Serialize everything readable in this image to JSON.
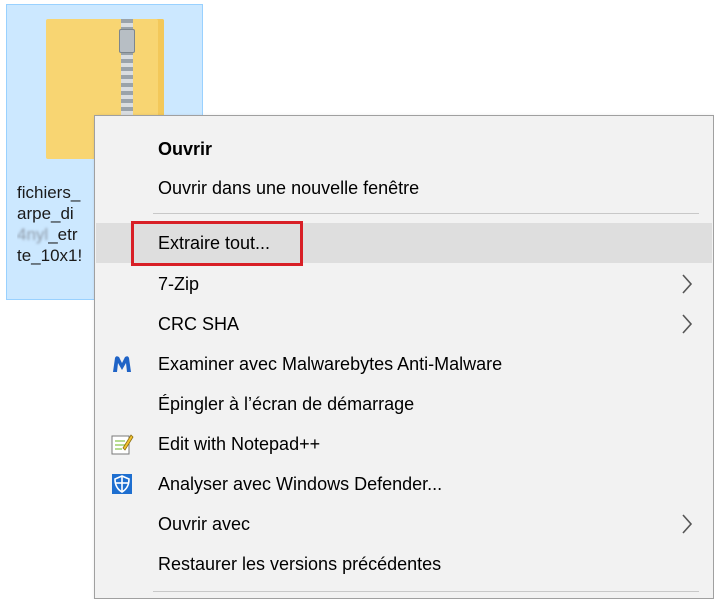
{
  "file": {
    "name_lines": [
      "fichiers_",
      "arpe_di",
      "_etr",
      "te_10x1!"
    ],
    "icon": "zip-folder-icon"
  },
  "context_menu": {
    "items": [
      {
        "label": "Ouvrir",
        "bold": true,
        "icon": null,
        "submenu": false
      },
      {
        "label": "Ouvrir dans une nouvelle fenêtre",
        "bold": false,
        "icon": null,
        "submenu": false
      },
      {
        "label": "Extraire tout...",
        "bold": false,
        "icon": null,
        "submenu": false,
        "hovered": true,
        "highlighted": true
      },
      {
        "label": "7-Zip",
        "bold": false,
        "icon": null,
        "submenu": true
      },
      {
        "label": "CRC SHA",
        "bold": false,
        "icon": null,
        "submenu": true
      },
      {
        "label": "Examiner avec Malwarebytes Anti-Malware",
        "bold": false,
        "icon": "malwarebytes-icon",
        "submenu": false
      },
      {
        "label": "Épingler à l’écran de démarrage",
        "bold": false,
        "icon": null,
        "submenu": false
      },
      {
        "label": "Edit with Notepad++",
        "bold": false,
        "icon": "notepad-plus-plus-icon",
        "submenu": false
      },
      {
        "label": "Analyser avec Windows Defender...",
        "bold": false,
        "icon": "windows-defender-icon",
        "submenu": false
      },
      {
        "label": "Ouvrir avec",
        "bold": false,
        "icon": null,
        "submenu": true
      },
      {
        "label": "Restaurer les versions précédentes",
        "bold": false,
        "icon": null,
        "submenu": false
      }
    ]
  },
  "colors": {
    "menu_background": "#f2f2f2",
    "hover_background": "#dedede",
    "highlight_border": "#d81f26",
    "selection_background": "#cce8ff"
  }
}
